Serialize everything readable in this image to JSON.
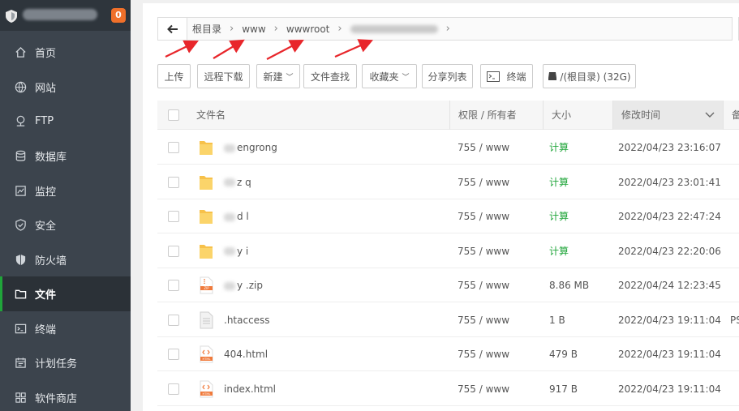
{
  "sidebar": {
    "badge": "0",
    "items": [
      {
        "label": "首页",
        "icon": "home-icon"
      },
      {
        "label": "网站",
        "icon": "globe-icon"
      },
      {
        "label": "FTP",
        "icon": "ftp-icon"
      },
      {
        "label": "数据库",
        "icon": "database-icon"
      },
      {
        "label": "监控",
        "icon": "monitor-icon"
      },
      {
        "label": "安全",
        "icon": "shield-check-icon"
      },
      {
        "label": "防火墙",
        "icon": "firewall-icon"
      },
      {
        "label": "文件",
        "icon": "folder-icon"
      },
      {
        "label": "终端",
        "icon": "terminal-icon"
      },
      {
        "label": "计划任务",
        "icon": "calendar-icon"
      },
      {
        "label": "软件商店",
        "icon": "apps-icon"
      }
    ],
    "active_index": 7
  },
  "path": {
    "crumbs": [
      "根目录",
      "www",
      "wwwroot"
    ]
  },
  "toolbar": {
    "upload": "上传",
    "remote_download": "远程下载",
    "new": "新建",
    "file_search": "文件查找",
    "favorites": "收藏夹",
    "share_list": "分享列表",
    "terminal": "终端",
    "disk": "/(根目录) (32G)"
  },
  "table": {
    "headers": {
      "name": "文件名",
      "perm": "权限 / 所有者",
      "size": "大小",
      "mtime": "修改时间",
      "extra": "备"
    },
    "rows": [
      {
        "type": "folder",
        "name": "engrong",
        "perm": "755 / www",
        "size": "计算",
        "mtime": "2022/04/23 23:16:07",
        "extra": ""
      },
      {
        "type": "folder",
        "name": "z   q",
        "perm": "755 / www",
        "size": "计算",
        "mtime": "2022/04/23 23:01:41",
        "extra": ""
      },
      {
        "type": "folder",
        "name": "d  l",
        "perm": "755 / www",
        "size": "计算",
        "mtime": "2022/04/23 22:47:24",
        "extra": ""
      },
      {
        "type": "folder",
        "name": "y   i",
        "perm": "755 / www",
        "size": "计算",
        "mtime": "2022/04/23 22:20:06",
        "extra": ""
      },
      {
        "type": "zip",
        "name": "y   .zip",
        "perm": "755 / www",
        "size": "8.86 MB",
        "mtime": "2022/04/24 12:23:45",
        "extra": ""
      },
      {
        "type": "file",
        "name": ".htaccess",
        "perm": "755 / www",
        "size": "1 B",
        "mtime": "2022/04/23 19:11:04",
        "extra": "PS"
      },
      {
        "type": "html",
        "name": "404.html",
        "perm": "755 / www",
        "size": "479 B",
        "mtime": "2022/04/23 19:11:04",
        "extra": ""
      },
      {
        "type": "html",
        "name": "index.html",
        "perm": "755 / www",
        "size": "917 B",
        "mtime": "2022/04/23 19:11:04",
        "extra": ""
      }
    ]
  },
  "colors": {
    "accent": "#20a53a",
    "annotation": "#e8262b",
    "badge": "#f0702a",
    "folder": "#f7c14a"
  }
}
